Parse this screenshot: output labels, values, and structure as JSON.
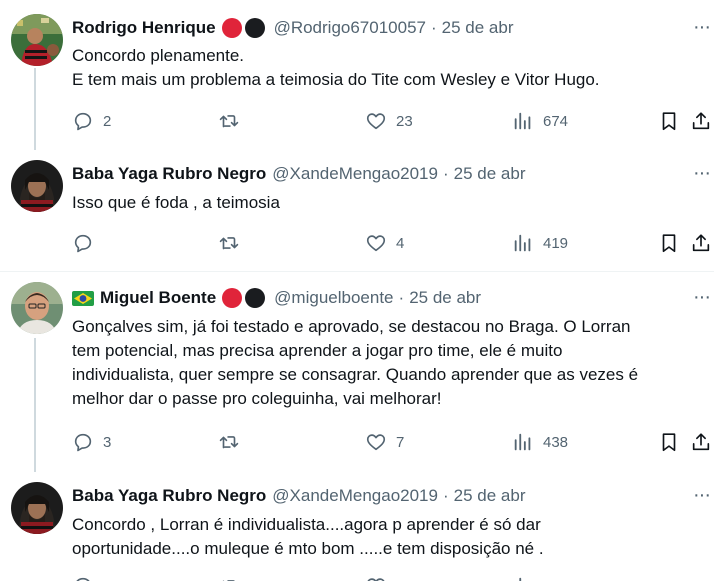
{
  "tweets": [
    {
      "name": "Rodrigo Henrique",
      "handle": "@Rodrigo67010057",
      "date": "25 de abr",
      "lines": [
        "Concordo plenamente.",
        "E tem mais um problema a teimosia do Tite com Wesley e Vitor Hugo."
      ],
      "replies": "2",
      "retweets": "",
      "likes": "23",
      "views": "674",
      "badges": [
        "#e0243a",
        "#1a1c1f"
      ]
    },
    {
      "name": "Baba Yaga Rubro Negro",
      "handle": "@XandeMengao2019",
      "date": "25 de abr",
      "lines": [
        "Isso que é foda , a teimosia"
      ],
      "replies": "",
      "retweets": "",
      "likes": "4",
      "views": "419",
      "badges": []
    },
    {
      "name": "Miguel Boente",
      "handle": "@miguelboente",
      "date": "25 de abr",
      "lines": [
        "Gonçalves sim, já foi testado e aprovado, se destacou no Braga. O Lorran",
        "tem potencial, mas precisa aprender a jogar pro time, ele é muito",
        "individualista, quer sempre se consagrar. Quando aprender que as vezes é",
        "melhor dar o passe pro coleguinha, vai melhorar!"
      ],
      "replies": "3",
      "retweets": "",
      "likes": "7",
      "views": "438",
      "badges": [
        "#e0243a",
        "#1a1c1f"
      ]
    },
    {
      "name": "Baba Yaga Rubro Negro",
      "handle": "@XandeMengao2019",
      "date": "25 de abr",
      "lines": [
        "Concordo , Lorran é individualista....agora p aprender é só dar",
        "oportunidade....o muleque é mto bom .....e tem disposição né ."
      ],
      "badges": []
    }
  ],
  "ui": {
    "dot": "·",
    "more": "···"
  },
  "colors": {
    "text": "#0f1419",
    "muted": "#536471",
    "divider": "#eff3f4",
    "thread": "#cfd9de",
    "badge_red": "#e0243a",
    "badge_black": "#1a1c1f"
  }
}
